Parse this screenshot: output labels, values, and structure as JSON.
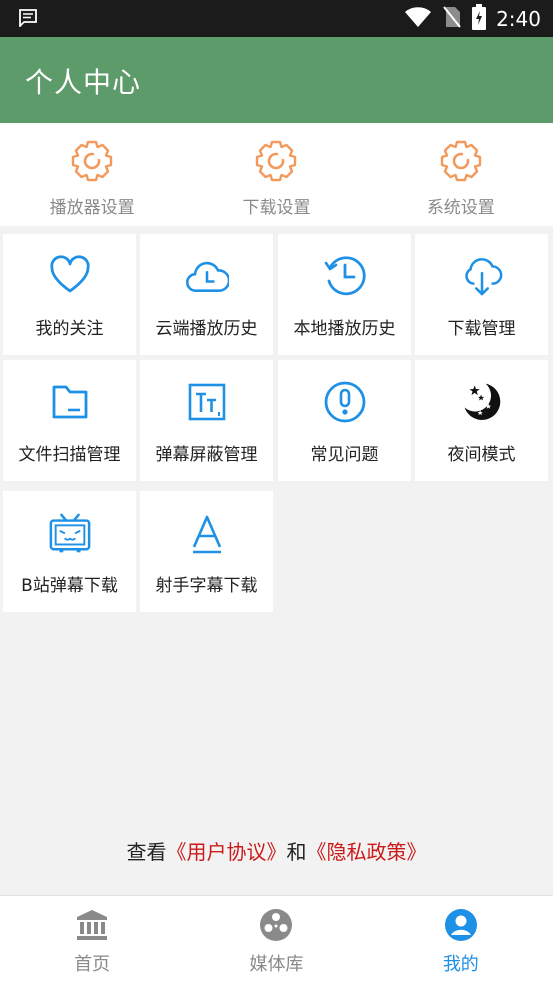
{
  "status_bar": {
    "time": "2:40"
  },
  "header": {
    "title": "个人中心"
  },
  "settings": [
    {
      "label": "播放器设置",
      "icon": "gear-icon"
    },
    {
      "label": "下载设置",
      "icon": "gear-icon"
    },
    {
      "label": "系统设置",
      "icon": "gear-icon"
    }
  ],
  "menu": [
    {
      "label": "我的关注",
      "icon": "heart-icon"
    },
    {
      "label": "云端播放历史",
      "icon": "cloud-clock-icon"
    },
    {
      "label": "本地播放历史",
      "icon": "history-clock-icon"
    },
    {
      "label": "下载管理",
      "icon": "cloud-download-icon"
    },
    {
      "label": "文件扫描管理",
      "icon": "folder-icon"
    },
    {
      "label": "弹幕屏蔽管理",
      "icon": "text-size-icon"
    },
    {
      "label": "常见问题",
      "icon": "alert-circle-icon"
    },
    {
      "label": "夜间模式",
      "icon": "moon-stars-icon"
    },
    {
      "label": "B站弹幕下载",
      "icon": "bilibili-tv-icon"
    },
    {
      "label": "射手字幕下载",
      "icon": "letter-a-icon"
    }
  ],
  "agreement": {
    "prefix": "查看",
    "user_agreement": "《用户协议》",
    "conjunction": "和",
    "privacy_policy": "《隐私政策》"
  },
  "bottom_nav": [
    {
      "label": "首页",
      "icon": "bank-icon",
      "active": false
    },
    {
      "label": "媒体库",
      "icon": "film-reel-icon",
      "active": false
    },
    {
      "label": "我的",
      "icon": "user-circle-icon",
      "active": true
    }
  ],
  "colors": {
    "header_bg": "#5d9b6b",
    "accent_blue": "#1e90e6",
    "gear_orange": "#f29a5c",
    "link_red": "#cc1a1a"
  }
}
